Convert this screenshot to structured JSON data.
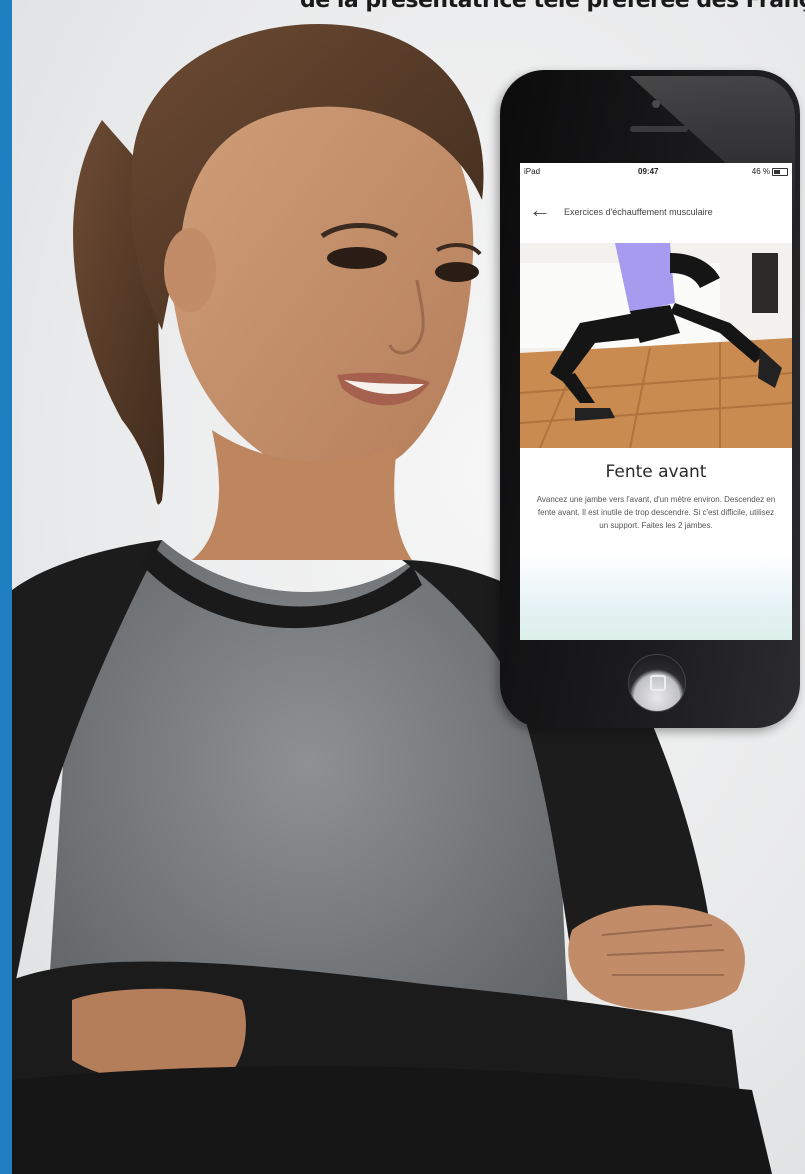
{
  "headline": {
    "text": "de la présentatrice télé préférée des Français"
  },
  "phone": {
    "status": {
      "carrier": "iPad",
      "time": "09:47",
      "battery": "46 %"
    },
    "nav": {
      "back_icon": "arrow-left-icon",
      "title": "Exercices d'échauffement musculaire"
    },
    "exercise": {
      "title": "Fente avant",
      "description": "Avancez une jambe vers l'avant, d'un mètre environ. Descendez en fente avant. Il est inutile de trop descendre. Si c'est difficile, utilisez un support. Faites les 2 jambes."
    }
  },
  "colors": {
    "accent_bar": "#1f7fc0",
    "phone_body": "#111112",
    "screen_bg": "#ffffff"
  }
}
